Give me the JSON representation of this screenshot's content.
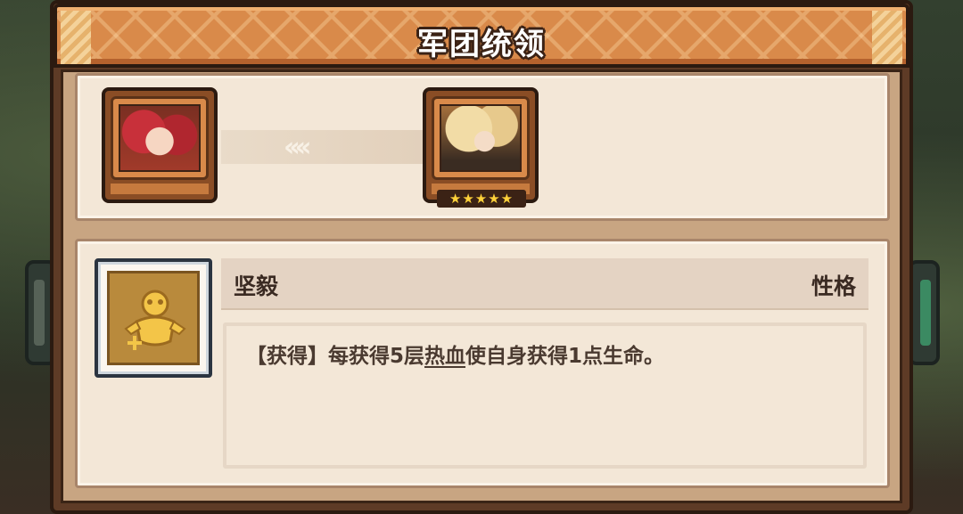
{
  "title": "军团统领",
  "portraits": [
    {
      "name": "portrait-left",
      "stars": ""
    },
    {
      "name": "portrait-right",
      "stars": "★★★★★"
    }
  ],
  "skill": {
    "name": "坚毅",
    "type": "性格",
    "icon": "golden-figure-icon",
    "description_prefix": "【获得】每获得5层",
    "description_keyword": "热血",
    "description_suffix": "使自身获得1点生命。"
  },
  "colors": {
    "title_bar": "#d98a4a",
    "panel": "#5e3b26",
    "card": "#f3e7d7",
    "star": "#ffd23a"
  }
}
